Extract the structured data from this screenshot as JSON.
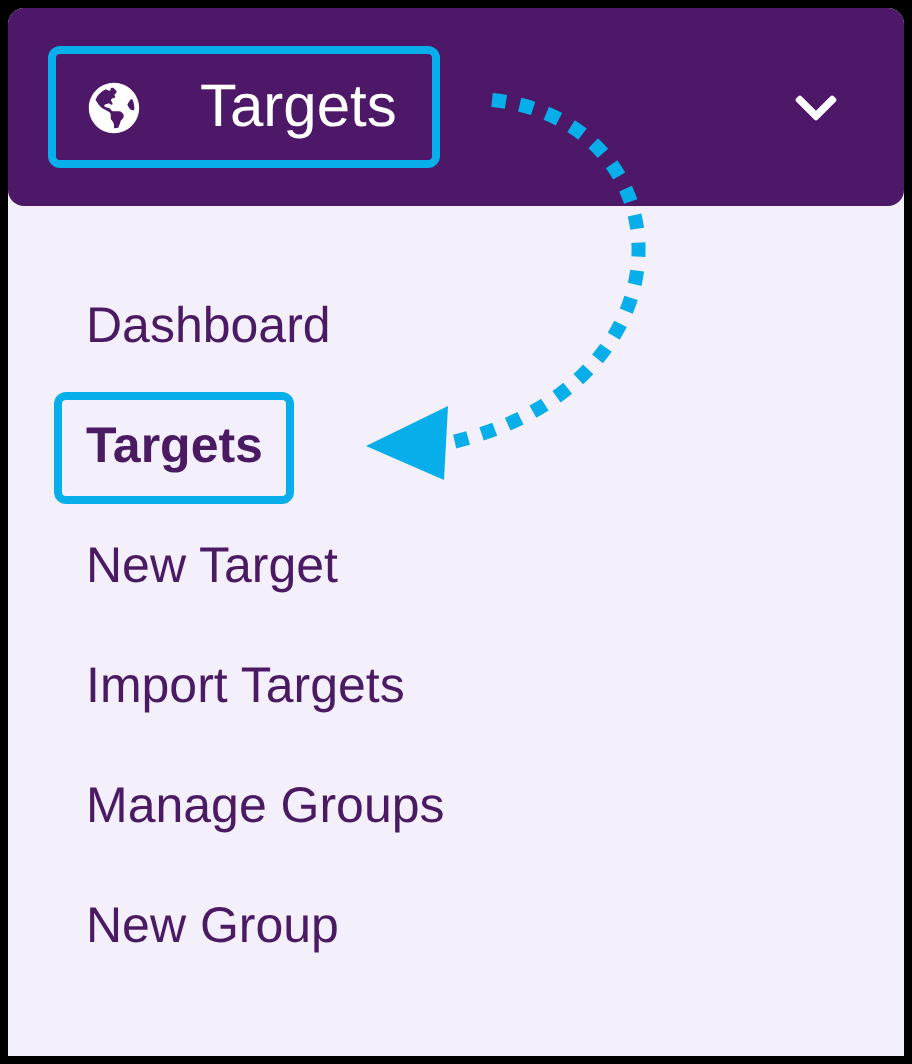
{
  "header": {
    "title": "Targets",
    "expanded": true
  },
  "menu": [
    {
      "label": "Dashboard",
      "selected": false
    },
    {
      "label": "Targets",
      "selected": true
    },
    {
      "label": "New Target",
      "selected": false
    },
    {
      "label": "Import Targets",
      "selected": false
    },
    {
      "label": "Manage Groups",
      "selected": false
    },
    {
      "label": "New Group",
      "selected": false
    }
  ]
}
